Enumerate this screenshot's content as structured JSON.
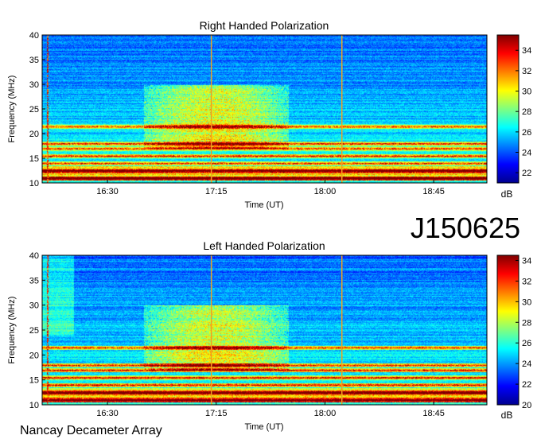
{
  "figure": {
    "event_id": "J150625",
    "instrument": "Nancay Decameter Array"
  },
  "chart_data": [
    {
      "type": "heatmap",
      "title": "Right Handed Polarization",
      "xlabel": "Time (UT)",
      "ylabel": "Frequency (MHz)",
      "x_ticks": [
        "16:30",
        "17:15",
        "18:00",
        "18:45"
      ],
      "y_ticks": [
        10,
        15,
        20,
        25,
        30,
        35,
        40
      ],
      "ylim": [
        10,
        40
      ],
      "colorbar": {
        "unit": "dB",
        "ticks": [
          22,
          24,
          26,
          28,
          30,
          32,
          34
        ],
        "range": [
          21,
          35.5
        ]
      },
      "vertical_markers_time": [
        "17:13",
        "18:07"
      ],
      "bright_bands_mhz": [
        11,
        12.5,
        14,
        15.5,
        17,
        18,
        21.5
      ],
      "burst_region": {
        "time_start": "16:45",
        "time_end": "17:45",
        "freq_range_mhz": [
          17,
          30
        ]
      }
    },
    {
      "type": "heatmap",
      "title": "Left Handed Polarization",
      "xlabel": "Time (UT)",
      "ylabel": "Frequency (MHz)",
      "x_ticks": [
        "16:30",
        "17:15",
        "18:00",
        "18:45"
      ],
      "y_ticks": [
        10,
        15,
        20,
        25,
        30,
        35,
        40
      ],
      "ylim": [
        10,
        40
      ],
      "colorbar": {
        "unit": "dB",
        "ticks": [
          20,
          22,
          24,
          26,
          28,
          30,
          32,
          34
        ],
        "range": [
          20,
          34.5
        ]
      },
      "vertical_markers_time": [
        "17:13",
        "18:07"
      ],
      "bright_bands_mhz": [
        11,
        12.5,
        14,
        15.5,
        17,
        18,
        21.5
      ],
      "burst_region": {
        "time_start": "16:45",
        "time_end": "17:45",
        "freq_range_mhz": [
          17,
          30
        ]
      }
    }
  ]
}
